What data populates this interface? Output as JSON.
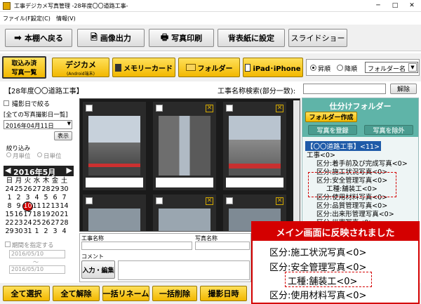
{
  "window": {
    "title": "工事デジカメ写真管理 -28年度〇〇道路工事-",
    "minimize": "─",
    "maximize": "□",
    "close": "✕"
  },
  "menu": [
    "ファイル(F)",
    "設定(C)",
    "情報(V)"
  ],
  "toolbar": {
    "back": "本棚へ戻る",
    "image_export": "画像出力",
    "photo_print": "写真印刷",
    "set_cover": "背表紙に設定",
    "slideshow": "スライドショー"
  },
  "sources": {
    "imported_list_line1": "取込み済",
    "imported_list_line2": "写真一覧",
    "digicam": "デジカメ",
    "digicam_sub": "(Android端末)",
    "memory_card": "メモリーカード",
    "folder": "フォルダー",
    "ipad": "iPad･iPhone",
    "sort_asc": "昇順",
    "sort_desc": "降順",
    "sort_key": "フォルダー名"
  },
  "project_label": "【28年度〇〇道路工事】",
  "search": {
    "label": "工事名称検索(部分一致):",
    "value": "",
    "clear": "解除"
  },
  "left_panel": {
    "filter_by_date": "撮影日で絞る",
    "all_photos_date_list": "[全ての写真撮影日一覧]",
    "selected_date": "2016年04月11日",
    "show_button": "表示",
    "narrow_label": "絞り込み",
    "by_month": "月単位",
    "by_day": "日単位",
    "calendar_title": "2016年5月",
    "weekdays": [
      "日",
      "月",
      "火",
      "水",
      "木",
      "金",
      "土"
    ],
    "weeks": [
      [
        "24",
        "25",
        "26",
        "27",
        "28",
        "29",
        "30"
      ],
      [
        "1",
        "2",
        "3",
        "4",
        "5",
        "6",
        "7"
      ],
      [
        "8",
        "9",
        "10",
        "11",
        "12",
        "13",
        "14"
      ],
      [
        "15",
        "16",
        "17",
        "18",
        "19",
        "20",
        "21"
      ],
      [
        "22",
        "23",
        "24",
        "25",
        "26",
        "27",
        "28"
      ],
      [
        "29",
        "30",
        "31",
        "1",
        "2",
        "3",
        "4"
      ]
    ],
    "selected_day": "10",
    "period_label": "期間を指定する",
    "period_from": "2016/05/10",
    "period_tilde": "〜",
    "period_to": "2016/05/10"
  },
  "details": {
    "construction_name_label": "工事名称",
    "photo_name_label": "写真名称",
    "comment_label": "コメント",
    "input_edit": "入力・編集"
  },
  "right_panel": {
    "title": "仕分けフォルダー",
    "create_folder": "フォルダー作成",
    "register_photo": "写真を登録",
    "exclude_photo": "写真を除外",
    "tree": [
      "【〇〇道路工事】<11>",
      "工事<0>",
      "区分:着手前及び完成写真<0>",
      "区分:施工状況写真<0>",
      "区分:安全管理写真<0>",
      "工種:舗装工<0>",
      "区分:使用材料写真<0>",
      "区分:品質管理写真<0>",
      "区分:出来形管理写真<0>",
      "区分:災害写真<0>"
    ]
  },
  "bottom_buttons": [
    "全て選択",
    "全て解除",
    "一括リネーム",
    "一括削除",
    "撮影日時"
  ],
  "overlay": {
    "banner": "メイン画面に反映されました",
    "lines": [
      "区分:施工状況写真<0>",
      "区分:安全管理写真<0>",
      "工種:舗装工<0>",
      "区分:使用材料写真<0>"
    ]
  },
  "colors": {
    "yellow_button": "#f2b800",
    "teal_header": "#5fb4a8",
    "highlight_red": "#d40000",
    "selected_blue": "#1e5aa8"
  }
}
